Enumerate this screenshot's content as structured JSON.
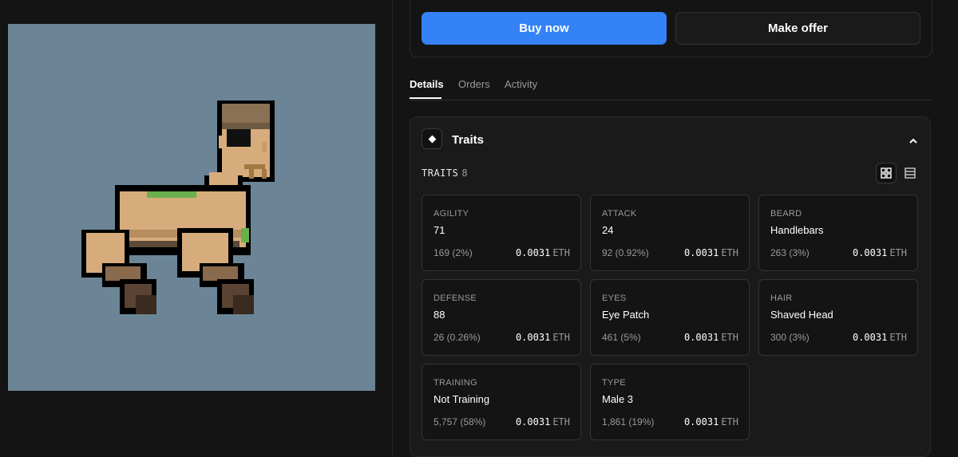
{
  "actions": {
    "buy_label": "Buy now",
    "offer_label": "Make offer"
  },
  "tabs": [
    {
      "label": "Details",
      "active": true
    },
    {
      "label": "Orders",
      "active": false
    },
    {
      "label": "Activity",
      "active": false
    }
  ],
  "traits_panel": {
    "title": "Traits",
    "count_label": "TRAITS",
    "count": "8",
    "price_unit": "ETH",
    "items": [
      {
        "name": "AGILITY",
        "value": "71",
        "count": "169 (2%)",
        "price": "0.0031"
      },
      {
        "name": "ATTACK",
        "value": "24",
        "count": "92 (0.92%)",
        "price": "0.0031"
      },
      {
        "name": "BEARD",
        "value": "Handlebars",
        "count": "263 (3%)",
        "price": "0.0031"
      },
      {
        "name": "DEFENSE",
        "value": "88",
        "count": "26 (0.26%)",
        "price": "0.0031"
      },
      {
        "name": "EYES",
        "value": "Eye Patch",
        "count": "461 (5%)",
        "price": "0.0031"
      },
      {
        "name": "HAIR",
        "value": "Shaved Head",
        "count": "300 (3%)",
        "price": "0.0031"
      },
      {
        "name": "TRAINING",
        "value": "Not Training",
        "count": "5,757 (58%)",
        "price": "0.0031"
      },
      {
        "name": "TYPE",
        "value": "Male 3",
        "count": "1,861 (19%)",
        "price": "0.0031"
      }
    ]
  },
  "colors": {
    "accent": "#3582f6",
    "image_bg": "#6b8596",
    "page_bg": "#141414",
    "panel_bg": "#1a1a1a"
  },
  "icons": {
    "traits": "diamond-icon",
    "collapse": "chevron-up-icon",
    "grid_view": "grid-view-icon",
    "list_view": "list-view-icon"
  }
}
